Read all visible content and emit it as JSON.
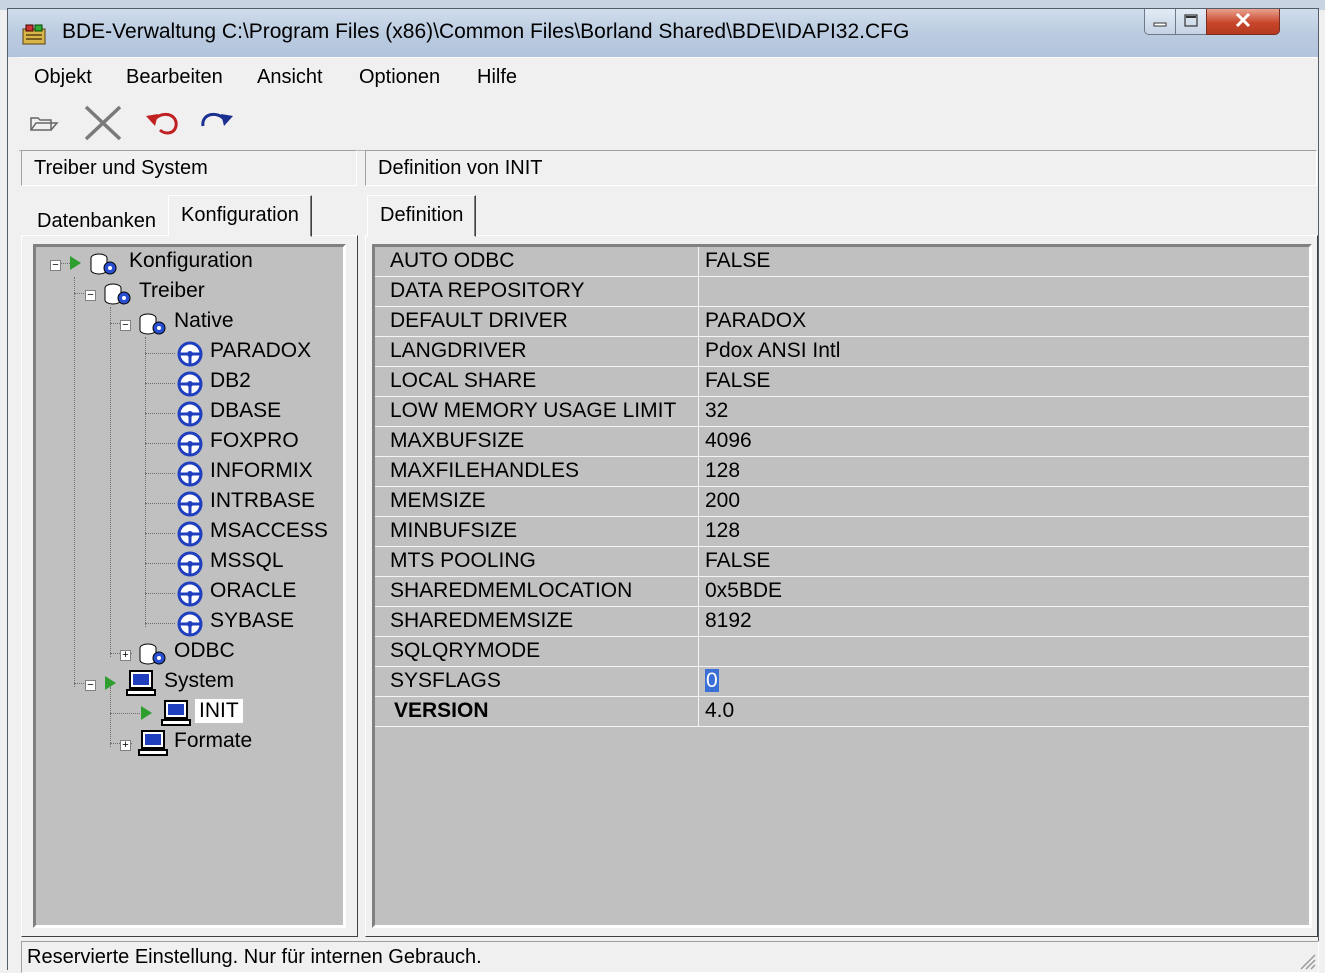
{
  "window": {
    "title": "BDE-Verwaltung  C:\\Program Files (x86)\\Common Files\\Borland Shared\\BDE\\IDAPI32.CFG"
  },
  "menu": [
    {
      "label": "Objekt"
    },
    {
      "label": "Bearbeiten"
    },
    {
      "label": "Ansicht"
    },
    {
      "label": "Optionen"
    },
    {
      "label": "Hilfe"
    }
  ],
  "toolbar": {
    "buttons": [
      {
        "icon": "open-folder-icon"
      },
      {
        "icon": "delete-x-icon"
      },
      {
        "icon": "undo-icon"
      },
      {
        "icon": "redo-icon"
      }
    ]
  },
  "left_panel": {
    "header": "Treiber und System",
    "tabs": [
      {
        "label": "Datenbanken",
        "active": false
      },
      {
        "label": "Konfiguration",
        "active": true
      }
    ],
    "tree": [
      {
        "label": "Konfiguration",
        "icon": "database-config-icon"
      },
      {
        "label": "Treiber",
        "icon": "database-config-icon"
      },
      {
        "label": "Native",
        "icon": "database-config-icon"
      },
      {
        "label": "PARADOX",
        "icon": "driver-wheel-icon"
      },
      {
        "label": "DB2",
        "icon": "driver-wheel-icon"
      },
      {
        "label": "DBASE",
        "icon": "driver-wheel-icon"
      },
      {
        "label": "FOXPRO",
        "icon": "driver-wheel-icon"
      },
      {
        "label": "INFORMIX",
        "icon": "driver-wheel-icon"
      },
      {
        "label": "INTRBASE",
        "icon": "driver-wheel-icon"
      },
      {
        "label": "MSACCESS",
        "icon": "driver-wheel-icon"
      },
      {
        "label": "MSSQL",
        "icon": "driver-wheel-icon"
      },
      {
        "label": "ORACLE",
        "icon": "driver-wheel-icon"
      },
      {
        "label": "SYBASE",
        "icon": "driver-wheel-icon"
      },
      {
        "label": "ODBC",
        "icon": "database-config-icon"
      },
      {
        "label": "System",
        "icon": "computer-icon"
      },
      {
        "label": "INIT",
        "icon": "computer-icon",
        "selected": true
      },
      {
        "label": "Formate",
        "icon": "computer-icon"
      }
    ]
  },
  "right_panel": {
    "header": "Definition von INIT",
    "tab": "Definition",
    "properties": [
      {
        "name": "AUTO ODBC",
        "value": "FALSE"
      },
      {
        "name": "DATA REPOSITORY",
        "value": ""
      },
      {
        "name": "DEFAULT DRIVER",
        "value": "PARADOX"
      },
      {
        "name": "LANGDRIVER",
        "value": "Pdox ANSI Intl"
      },
      {
        "name": "LOCAL SHARE",
        "value": "FALSE"
      },
      {
        "name": "LOW MEMORY USAGE LIMIT",
        "value": "32"
      },
      {
        "name": "MAXBUFSIZE",
        "value": "4096"
      },
      {
        "name": "MAXFILEHANDLES",
        "value": "128"
      },
      {
        "name": "MEMSIZE",
        "value": "200"
      },
      {
        "name": "MINBUFSIZE",
        "value": "128"
      },
      {
        "name": "MTS POOLING",
        "value": "FALSE"
      },
      {
        "name": "SHAREDMEMLOCATION",
        "value": "0x5BDE"
      },
      {
        "name": "SHAREDMEMSIZE",
        "value": "8192"
      },
      {
        "name": "SQLQRYMODE",
        "value": ""
      },
      {
        "name": "SYSFLAGS",
        "value": "0",
        "selected": true
      },
      {
        "name": "VERSION",
        "value": "4.0",
        "bold": true
      }
    ]
  },
  "status": {
    "text": "Reservierte Einstellung. Nur für internen Gebrauch."
  },
  "colors": {
    "titlebar": "#bacbe0",
    "panel_bg": "#c0c0c0",
    "selection": "#3b6fd8",
    "close_button": "#c8462c",
    "expand_arrow": "#2e9e2e",
    "driver_icon": "#1f3fbf"
  }
}
